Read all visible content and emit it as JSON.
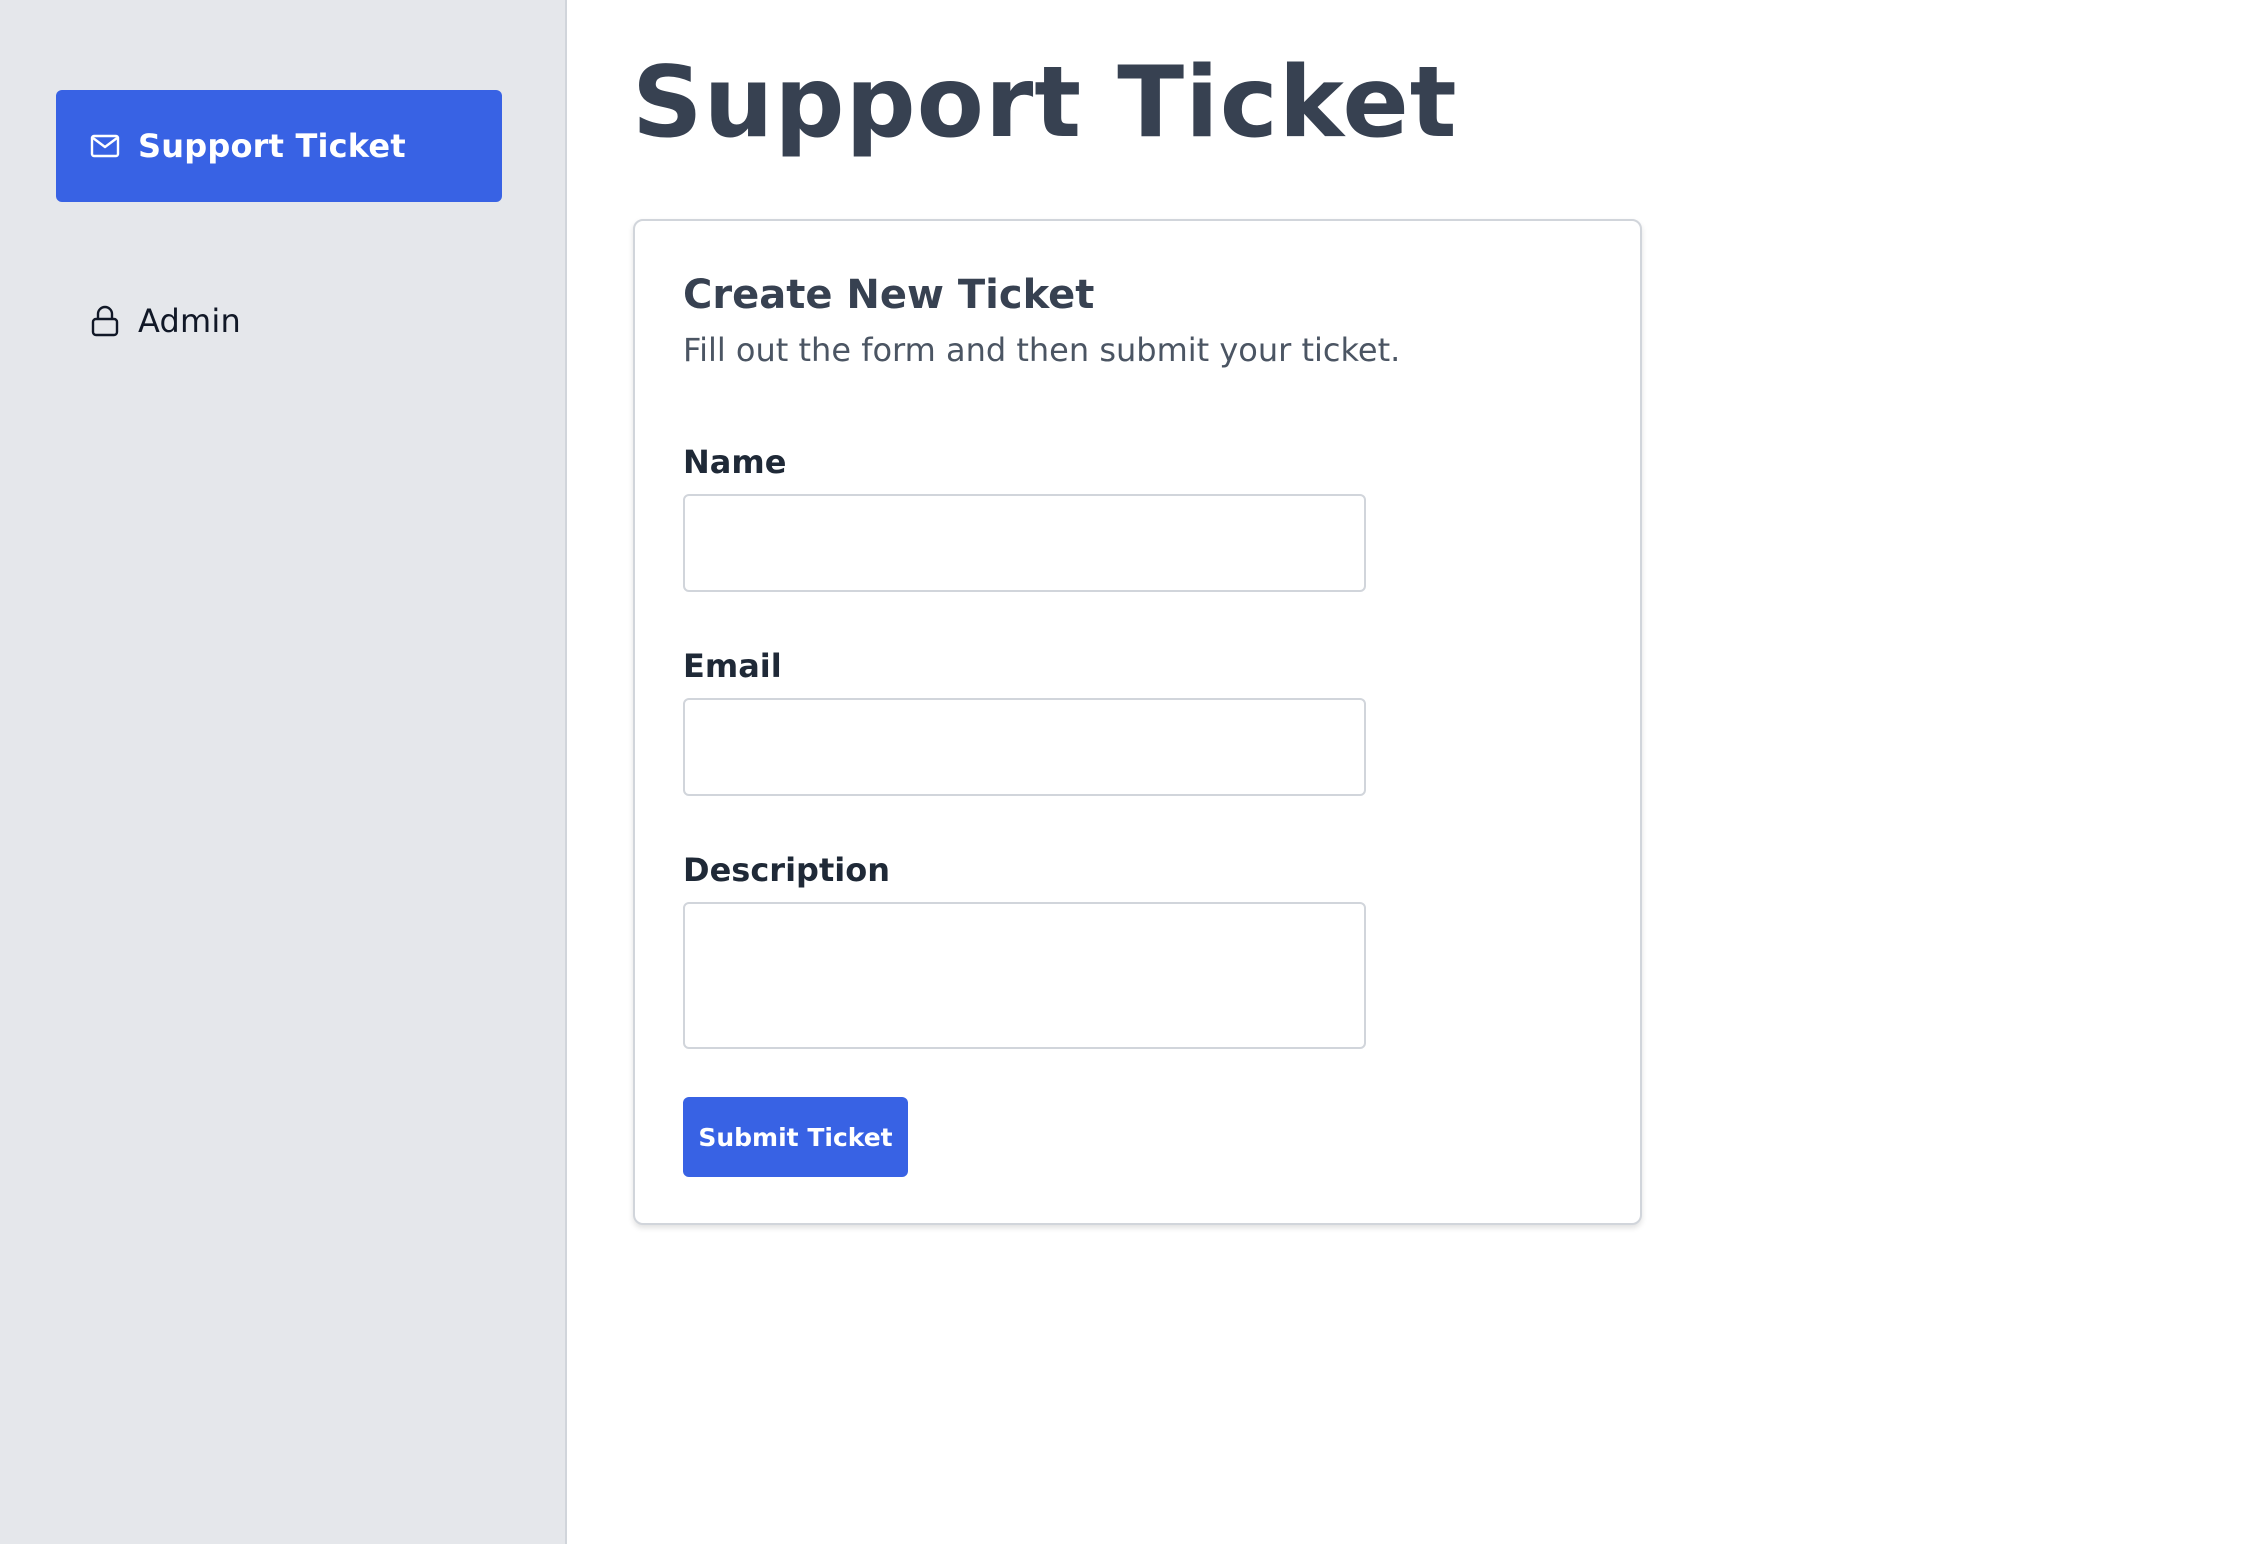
{
  "sidebar": {
    "items": [
      {
        "label": "Support Ticket",
        "icon": "mail-icon",
        "active": true
      },
      {
        "label": "Admin",
        "icon": "lock-icon",
        "active": false
      }
    ]
  },
  "main": {
    "page_title": "Support Ticket",
    "form": {
      "title": "Create New Ticket",
      "subtitle": "Fill out the form and then submit your ticket.",
      "fields": {
        "name": {
          "label": "Name",
          "value": "",
          "placeholder": ""
        },
        "email": {
          "label": "Email",
          "value": "",
          "placeholder": ""
        },
        "description": {
          "label": "Description",
          "value": "",
          "placeholder": ""
        }
      },
      "submit_label": "Submit Ticket"
    }
  },
  "colors": {
    "accent": "#3862e4",
    "sidebar_bg": "#e5e7eb",
    "heading": "#374151"
  }
}
